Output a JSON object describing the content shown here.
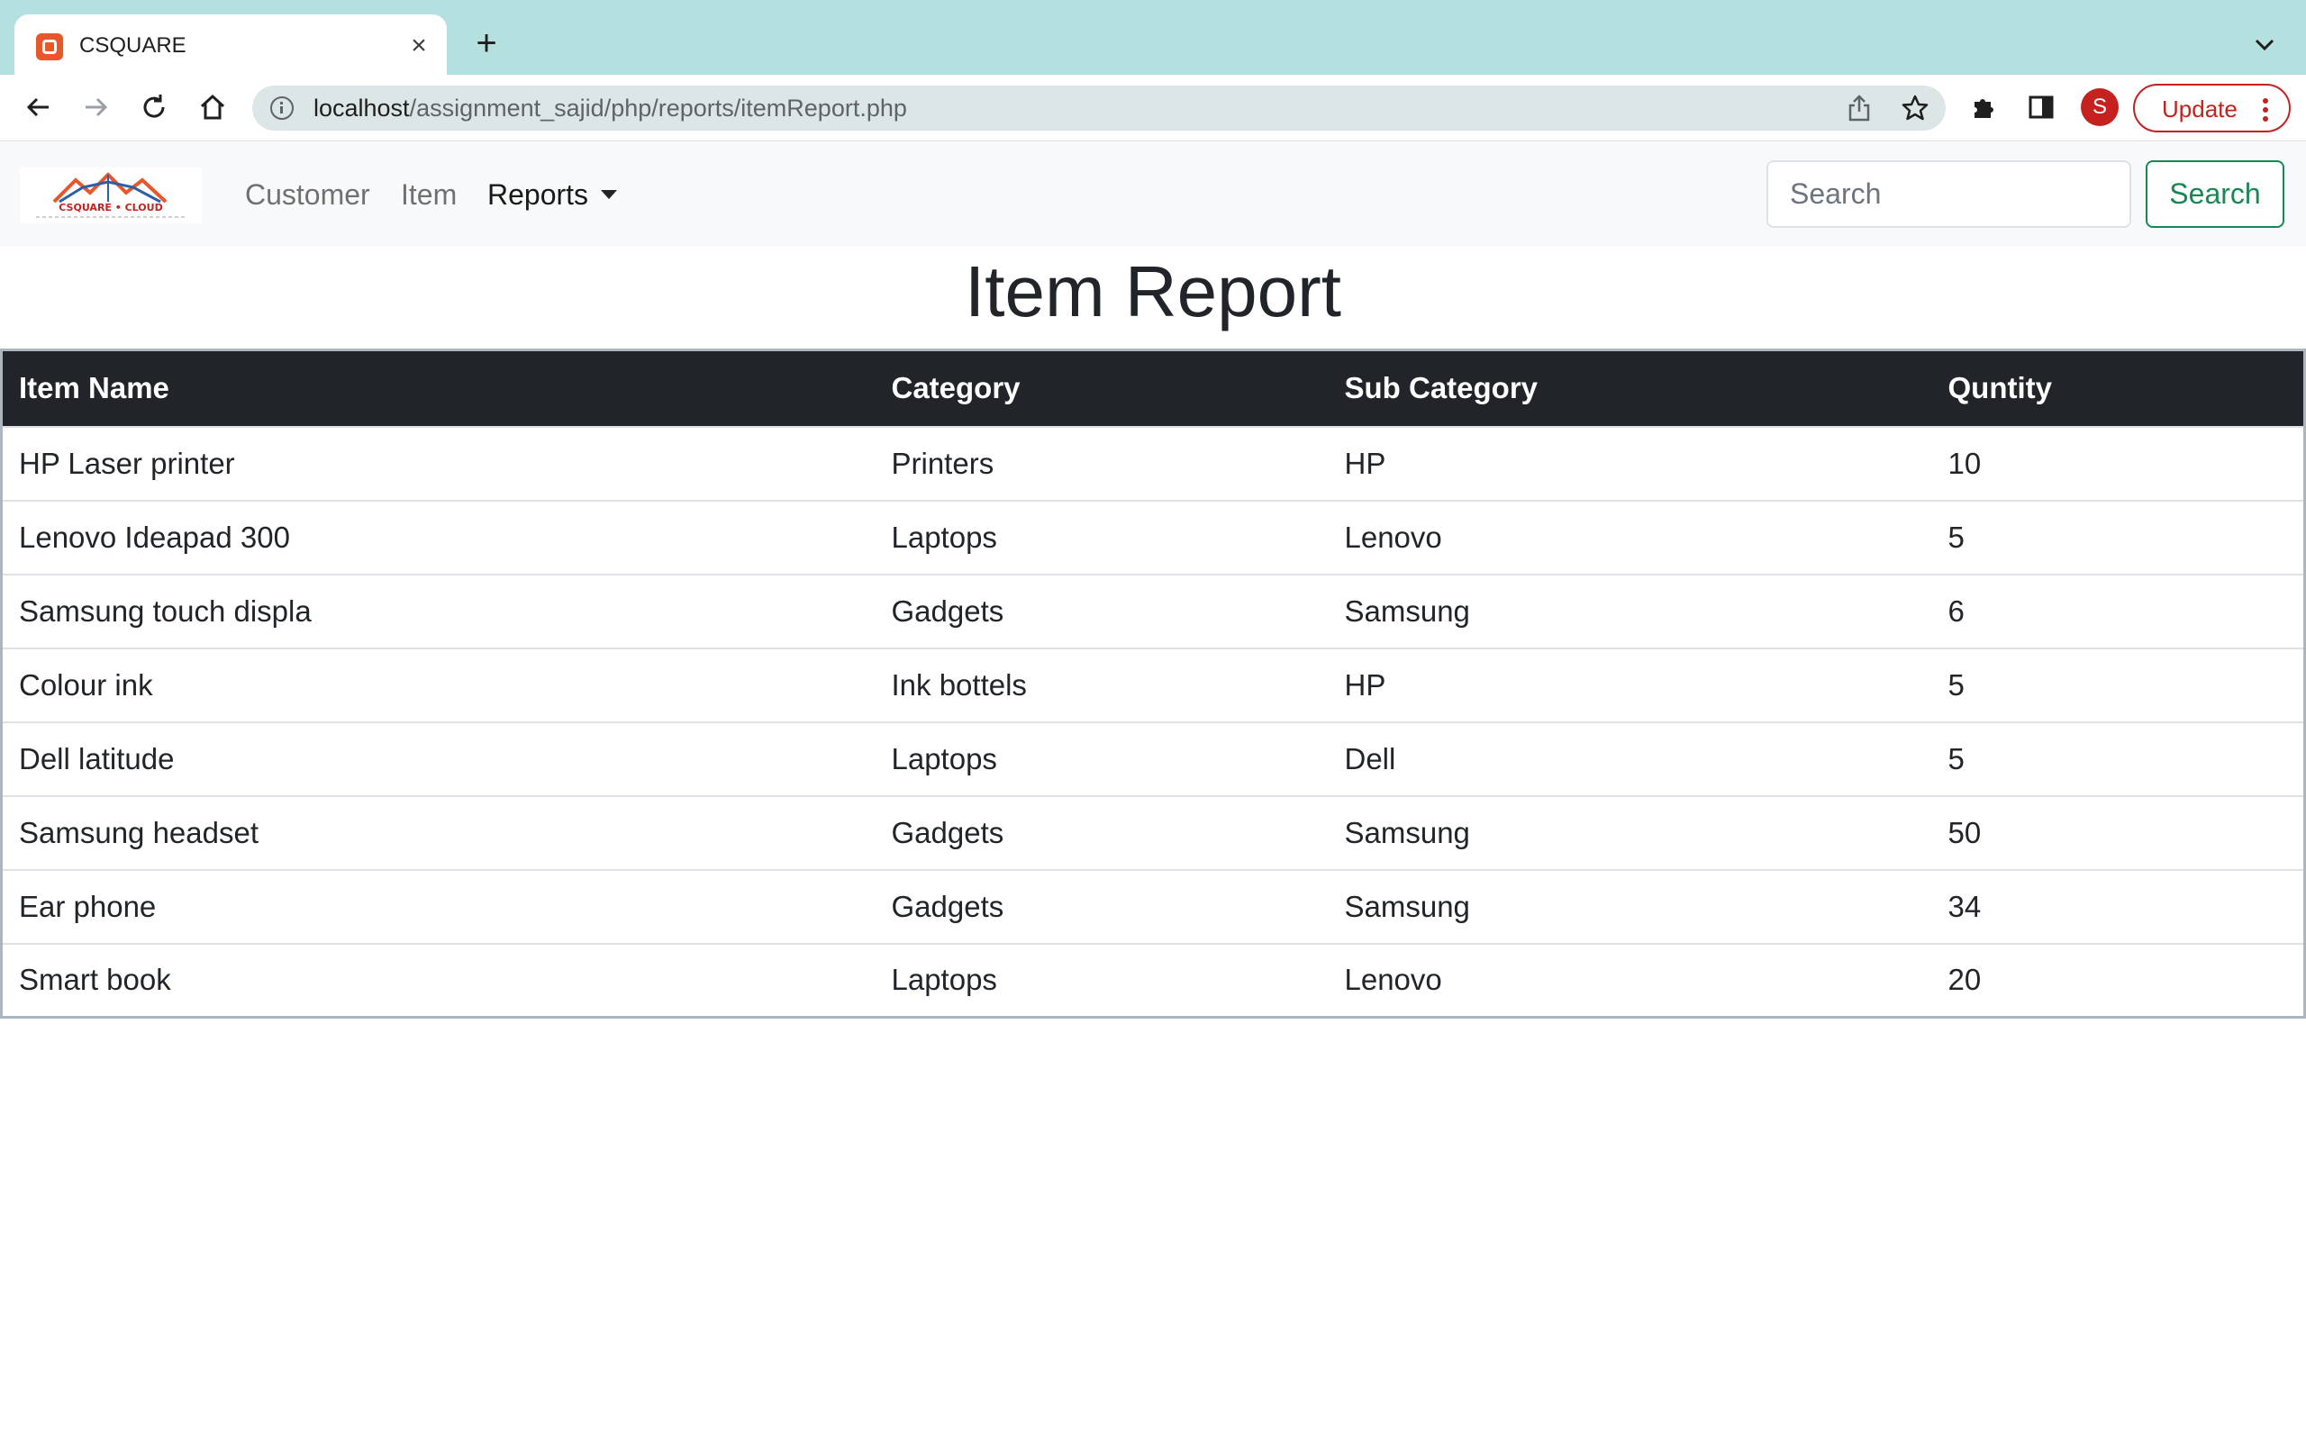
{
  "browser": {
    "tab_title": "CSQUARE",
    "url_host": "localhost",
    "url_path": "/assignment_sajid/php/reports/itemReport.php",
    "profile_initial": "S",
    "update_label": "Update"
  },
  "navbar": {
    "brand": {
      "text": "CSQUARE • CLOUD"
    },
    "links": [
      {
        "label": "Customer"
      },
      {
        "label": "Item"
      },
      {
        "label": "Reports"
      }
    ],
    "search": {
      "placeholder": "Search",
      "button_label": "Search"
    }
  },
  "page": {
    "title": "Item Report"
  },
  "table": {
    "headers": [
      "Item Name",
      "Category",
      "Sub Category",
      "Quntity"
    ],
    "rows": [
      [
        "HP Laser printer",
        "Printers",
        "HP",
        "10"
      ],
      [
        "Lenovo Ideapad 300",
        "Laptops",
        "Lenovo",
        "5"
      ],
      [
        "Samsung touch displa",
        "Gadgets",
        "Samsung",
        "6"
      ],
      [
        "Colour ink",
        "Ink bottels",
        "HP",
        "5"
      ],
      [
        "Dell latitude",
        "Laptops",
        "Dell",
        "5"
      ],
      [
        "Samsung headset",
        "Gadgets",
        "Samsung",
        "50"
      ],
      [
        "Ear phone",
        "Gadgets",
        "Samsung",
        "34"
      ],
      [
        "Smart book",
        "Laptops",
        "Lenovo",
        "20"
      ]
    ]
  },
  "colors": {
    "tabstrip": "#b4e0df",
    "table_header_bg": "#212529",
    "search_button": "#198754",
    "update_accent": "#c5221f"
  }
}
